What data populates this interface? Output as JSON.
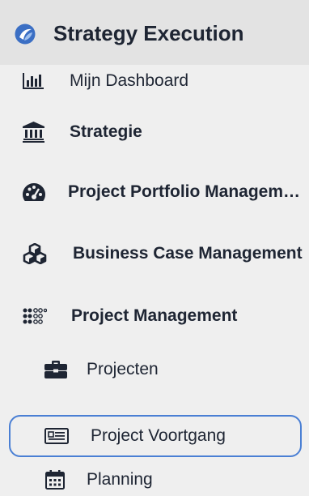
{
  "app": {
    "title": "Strategy Execution",
    "logo_icon": "app-logo-icon"
  },
  "nav": {
    "items": [
      {
        "label": "Mijn Dashboard",
        "icon": "bar-chart-icon",
        "bold": false
      },
      {
        "label": "Strategie",
        "icon": "institution-icon",
        "bold": true
      },
      {
        "label": "Project Portfolio Managem…",
        "icon": "dashboard-gauge-icon",
        "bold": true
      },
      {
        "label": "Business Case Management",
        "icon": "cubes-icon",
        "bold": true
      },
      {
        "label": "Project Management",
        "icon": "dots-grid-icon",
        "bold": true
      },
      {
        "label": "Projecten",
        "icon": "briefcase-icon",
        "bold": false
      },
      {
        "label": "Project Voortgang",
        "icon": "newspaper-icon",
        "bold": false,
        "selected": true
      },
      {
        "label": "Planning",
        "icon": "calendar-icon",
        "bold": false
      }
    ]
  },
  "colors": {
    "header_bg": "#e3e3e3",
    "sidebar_bg": "#efefef",
    "text": "#1e2533",
    "selection_border": "#4a7fd4",
    "logo": "#3b6fc4"
  }
}
